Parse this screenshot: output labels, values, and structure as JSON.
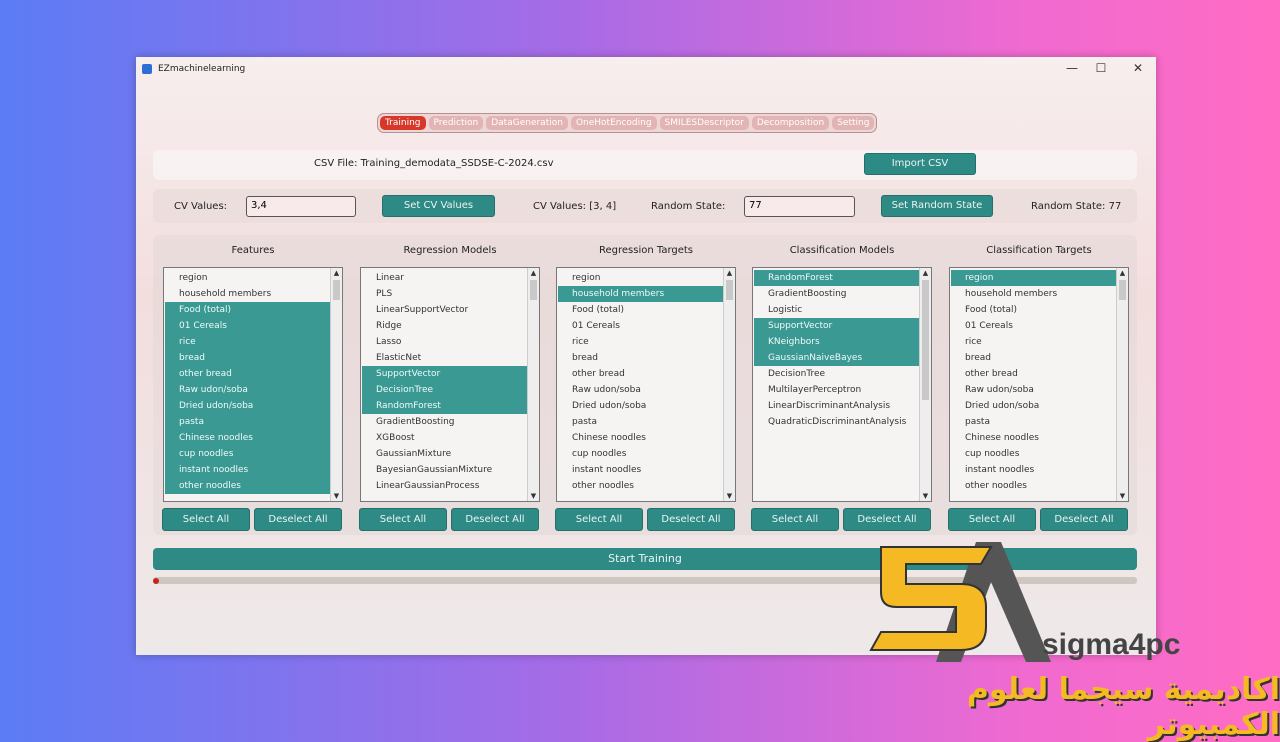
{
  "window": {
    "title": "EZmachinelearning",
    "minimize": "—",
    "maximize": "☐",
    "close": "✕"
  },
  "tabs": [
    {
      "label": "Training",
      "active": true
    },
    {
      "label": "Prediction"
    },
    {
      "label": "DataGeneration"
    },
    {
      "label": "OneHotEncoding"
    },
    {
      "label": "SMILESDescriptor"
    },
    {
      "label": "Decomposition"
    },
    {
      "label": "Setting"
    }
  ],
  "csv": {
    "file_label": "CSV File: Training_demodata_SSDSE-C-2024.csv",
    "import_button": "Import CSV"
  },
  "cv": {
    "label": "CV Values:",
    "value": "3,4",
    "set_button": "Set CV Values",
    "status": "CV Values: [3, 4]"
  },
  "random_state": {
    "label": "Random State:",
    "value": "77",
    "set_button": "Set Random State",
    "status": "Random State: 77"
  },
  "panels": [
    {
      "title": "Features",
      "items": [
        "region",
        "household members",
        "Food (total)",
        "01 Cereals",
        "rice",
        "bread",
        "other bread",
        "Raw udon/soba",
        "Dried udon/soba",
        "pasta",
        "Chinese noodles",
        "cup noodles",
        "instant noodles",
        "other noodles"
      ],
      "selected": [
        2,
        3,
        4,
        5,
        6,
        7,
        8,
        9,
        10,
        11,
        12,
        13
      ]
    },
    {
      "title": "Regression Models",
      "items": [
        "Linear",
        "PLS",
        "LinearSupportVector",
        "Ridge",
        "Lasso",
        "ElasticNet",
        "SupportVector",
        "DecisionTree",
        "RandomForest",
        "GradientBoosting",
        "XGBoost",
        "GaussianMixture",
        "BayesianGaussianMixture",
        "LinearGaussianProcess"
      ],
      "selected": [
        6,
        7,
        8
      ]
    },
    {
      "title": "Regression Targets",
      "items": [
        "region",
        "household members",
        "Food (total)",
        "01 Cereals",
        "rice",
        "bread",
        "other bread",
        "Raw udon/soba",
        "Dried udon/soba",
        "pasta",
        "Chinese noodles",
        "cup noodles",
        "instant noodles",
        "other noodles"
      ],
      "selected": [
        1
      ]
    },
    {
      "title": "Classification Models",
      "items": [
        "RandomForest",
        "GradientBoosting",
        "Logistic",
        "SupportVector",
        "KNeighbors",
        "GaussianNaiveBayes",
        "DecisionTree",
        "MultilayerPerceptron",
        "LinearDiscriminantAnalysis",
        "QuadraticDiscriminantAnalysis"
      ],
      "selected": [
        0,
        3,
        4,
        5
      ]
    },
    {
      "title": "Classification Targets",
      "items": [
        "region",
        "household members",
        "Food (total)",
        "01 Cereals",
        "rice",
        "bread",
        "other bread",
        "Raw udon/soba",
        "Dried udon/soba",
        "pasta",
        "Chinese noodles",
        "cup noodles",
        "instant noodles",
        "other noodles"
      ],
      "selected": [
        0
      ]
    }
  ],
  "select_all": "Select All",
  "deselect_all": "Deselect All",
  "start_button": "Start Training",
  "progress": 0,
  "watermark": {
    "brand": "sigma4pc",
    "arabic": "اكاديمية سيجما لعلوم الكمبيوتر"
  },
  "colors": {
    "accent": "#2e8a84",
    "active_tab": "#d8382a"
  }
}
